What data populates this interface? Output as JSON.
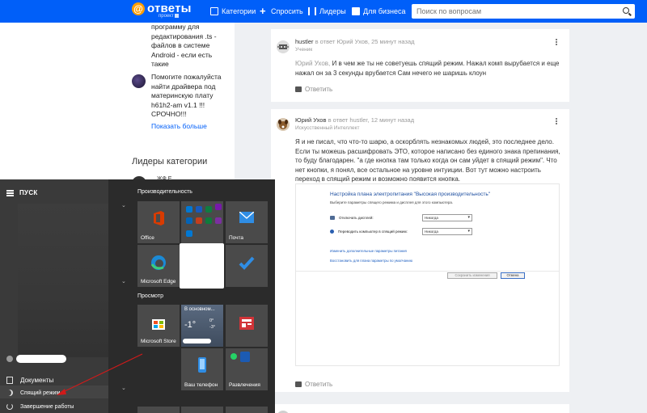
{
  "topbar": {
    "brand": "ответы",
    "brand_sub": "проект",
    "nav": [
      "Категории",
      "Спросить",
      "Лидеры",
      "Для бизнеса"
    ],
    "search_placeholder": "Поиск по вопросам"
  },
  "sidebar": {
    "related": [
      {
        "text": "программу для редактирования .ts - файлов в системе Android - если есть такие"
      },
      {
        "text": "Помогите пожалуйста найти драйвера под материнскую плату h61h2-am v1.1 !!! СРОЧНО!!!"
      }
    ],
    "show_more": "Показать больше",
    "leaders_title": "Лидеры категории",
    "leader_name_partial": "ЖФ Е"
  },
  "feed": {
    "comments": [
      {
        "author": "hustler",
        "in_reply": "в ответ Юрий Ухов,",
        "time": "25 минут назад",
        "rank": "Ученик",
        "quote_name": "Юрий Ухов,",
        "text": "И в чем же ты не советуешь спящий режим. Нажал комп вырубается и еще нажал он за 3 секунды врубается  Сам нечего не шаришь клоун",
        "reply_label": "Ответить"
      },
      {
        "author": "Юрий Ухов",
        "in_reply": "в ответ hustler,",
        "time": "12 минут назад",
        "rank": "Искусственный Интеллект",
        "text": "Я и не писал, что что-то шарю, а оскорблять незнакомых людей, это последнее дело. Если ты можешь расшифровать ЭТО, которое написано без единого знака препинания, то буду благодарен. \"а где кнопка там только когда он сам уйдет в спящий режим\". Что нет кнопки, я понял, все остальное на уровне интуиции. Вот тут можно настроить переход в спящий режим и возможно появится кнопка.",
        "reply_label": "Ответить"
      }
    ],
    "dialog": {
      "title": "Настройка плана электропитания \"Высокая производительность\"",
      "subtitle": "Выберите параметры спящего режима и дисплея для этого компьютера.",
      "row1_label": "Отключать дисплей:",
      "row1_value": "Никогда",
      "row2_label": "Переводить компьютер в спящий режим:",
      "row2_value": "Никогда",
      "link1": "Изменить дополнительные параметры питания",
      "link2": "Восстановить для плана параметры по умолчанию",
      "save_btn": "Сохранить изменения",
      "cancel_btn": "Отмена"
    }
  },
  "startmenu": {
    "title": "ПУСК",
    "groups": [
      "Производительность",
      "Просмотр"
    ],
    "tiles": [
      "Office",
      "Почта",
      "Microsoft Edge",
      "Microsoft Store",
      "В основном...",
      "Ваш телефон",
      "Развлечения"
    ],
    "weather_temp": "-1°",
    "weather_hi": "0°",
    "weather_lo": "-3°",
    "items": [
      "Документы",
      "Спящий режим",
      "Завершение работы"
    ]
  },
  "colors": {
    "brand_blue": "#005ff9",
    "annotation_red": "#d11a1a",
    "start_bg": "#2b2b2b"
  }
}
